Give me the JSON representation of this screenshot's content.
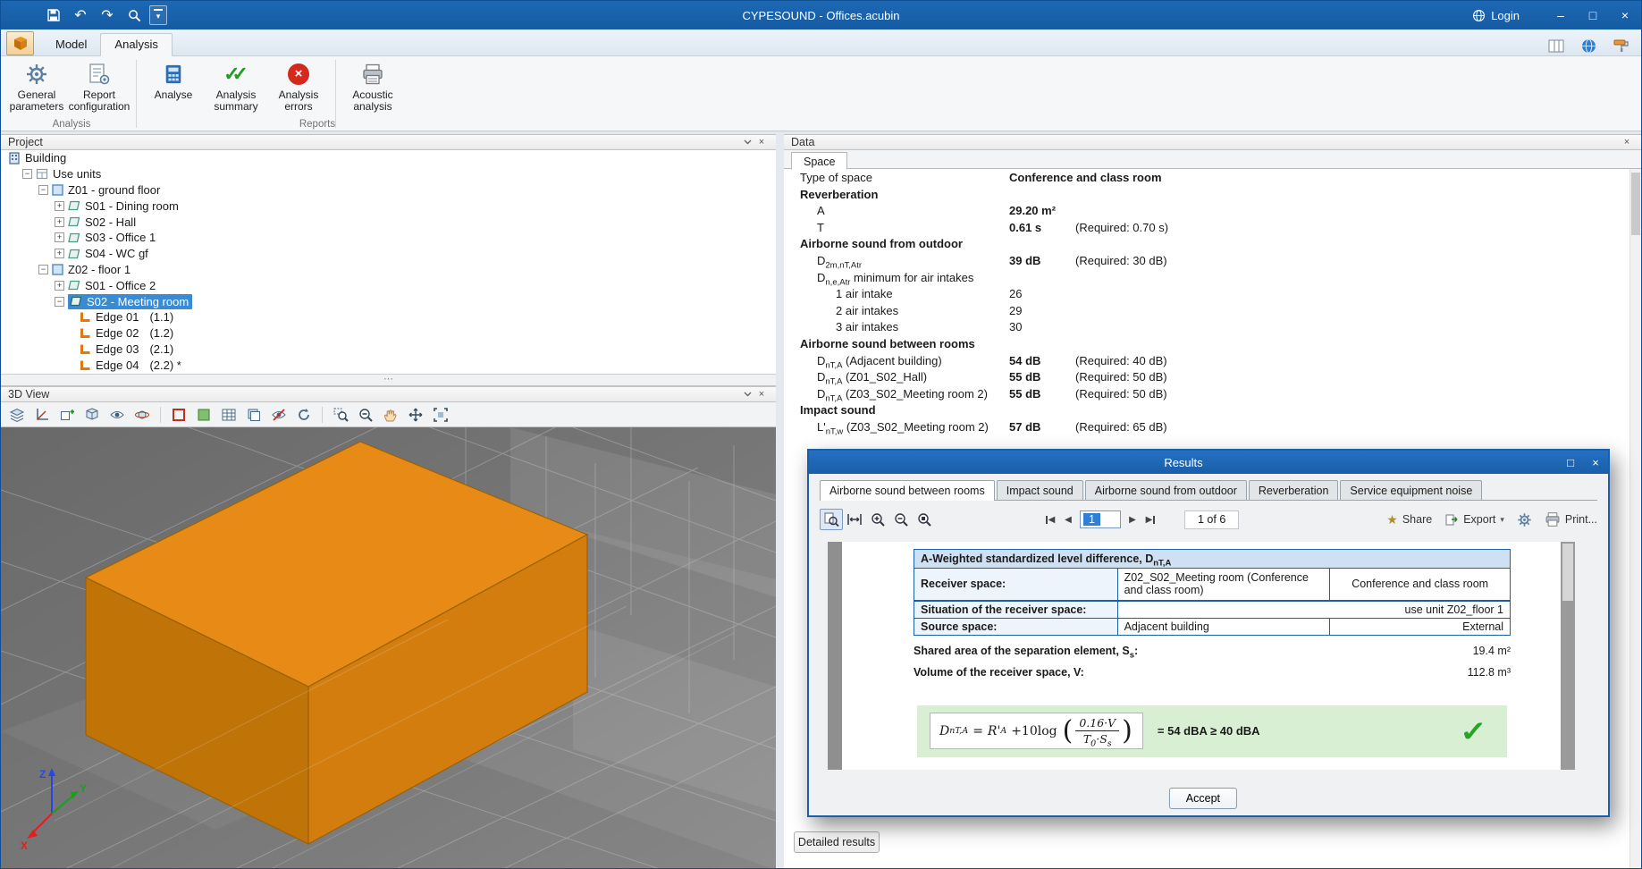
{
  "titlebar": {
    "title": "CYPESOUND - Offices.acubin",
    "login_label": "Login"
  },
  "tab_row": {
    "model_label": "Model",
    "analysis_label": "Analysis"
  },
  "ribbon": {
    "analysis_group_label": "Analysis",
    "reports_group_label": "Reports",
    "general_parameters": "General parameters",
    "report_configuration": "Report configuration",
    "analyse": "Analyse",
    "analysis_summary": "Analysis summary",
    "analysis_errors": "Analysis errors",
    "acoustic_analysis": "Acoustic analysis"
  },
  "project": {
    "title": "Project",
    "tree": [
      {
        "label": "Building"
      },
      {
        "label": "Use units"
      },
      {
        "label": "Z01 - ground floor"
      },
      {
        "label": "S01 - Dining room"
      },
      {
        "label": "S02 - Hall"
      },
      {
        "label": "S03 - Office 1"
      },
      {
        "label": "S04 - WC gf"
      },
      {
        "label": "Z02 - floor 1"
      },
      {
        "label": "S01 - Office 2"
      },
      {
        "label": "S02 - Meeting room"
      },
      {
        "label": "Edge 01",
        "suffix": "(1.1)"
      },
      {
        "label": "Edge 02",
        "suffix": "(1.2)"
      },
      {
        "label": "Edge 03",
        "suffix": "(2.1)"
      },
      {
        "label": "Edge 04",
        "suffix": "(2.2) *"
      }
    ]
  },
  "view3d": {
    "title": "3D View",
    "axes": {
      "x": "X",
      "y": "Y",
      "z": "Z"
    }
  },
  "data_panel": {
    "title": "Data",
    "tab_label": "Space",
    "rows": [
      {
        "b": "Type of space",
        "v": "Conference and class room"
      },
      {
        "b": "Reverberation"
      },
      {
        "b": "A",
        "v": "29.20 m²"
      },
      {
        "b": "T",
        "v": "0.61 s",
        "r": "(Required: 0.70 s)"
      },
      {
        "b": "Airborne sound from outdoor"
      },
      {
        "b": "D",
        "s": "2m,nT,Atr",
        "v": "39 dB",
        "r": "(Required: 30 dB)"
      },
      {
        "b": "D",
        "s": "n,e,Atr",
        "p": " minimum for air intakes"
      },
      {
        "b": "1 air intake",
        "v": "26"
      },
      {
        "b": "2 air intakes",
        "v": "29"
      },
      {
        "b": "3 air intakes",
        "v": "30"
      },
      {
        "b": "Airborne sound between rooms"
      },
      {
        "b": "D",
        "s": "nT,A",
        "p": " (Adjacent building)",
        "v": "54 dB",
        "r": "(Required: 40 dB)"
      },
      {
        "b": "D",
        "s": "nT,A",
        "p": " (Z01_S02_Hall)",
        "v": "55 dB",
        "r": "(Required: 50 dB)"
      },
      {
        "b": "D",
        "s": "nT,A",
        "p": " (Z03_S02_Meeting room 2)",
        "v": "55 dB",
        "r": "(Required: 50 dB)"
      },
      {
        "b": "Impact sound"
      },
      {
        "b": "L'",
        "s": "nT,w",
        "p": " (Z03_S02_Meeting room 2)",
        "v": "57 dB",
        "r": "(Required: 65 dB)"
      }
    ],
    "detailed_results_label": "Detailed results"
  },
  "results": {
    "title": "Results",
    "tabs": [
      "Airborne sound between rooms",
      "Impact sound",
      "Airborne sound from outdoor",
      "Reverberation",
      "Service equipment noise"
    ],
    "page_value": "1",
    "page_of": "1 of 6",
    "share_label": "Share",
    "export_label": "Export",
    "print_label": "Print...",
    "accept_label": "Accept",
    "doc": {
      "title_b": "A-Weighted standardized level difference, D",
      "title_s": "nT,A",
      "receiver_label": "Receiver space:",
      "receiver_value": "Z02_S02_Meeting room (Conference and class room)",
      "receiver_type": "Conference and class room",
      "situation_label": "Situation of the receiver space:",
      "situation_value": "use unit Z02_floor 1",
      "source_label": "Source space:",
      "source_value": "Adjacent building",
      "source_type": "External",
      "shared_b": "Shared area of the separation element, S",
      "shared_s": "s",
      "shared_p": ":",
      "shared_value": "19.4 m²",
      "volume_label": "Volume of the receiver space, V:",
      "volume_value": "112.8 m³",
      "formula": {
        "lhs_b": "D",
        "lhs_s": "nT,A",
        "eq": "=",
        "r_b": "R'",
        "r_s": "A",
        "op": "+10log",
        "num": "0.16·V",
        "den_b": "T",
        "den_s1": "0",
        "den_m": "·S",
        "den_s2": "s"
      },
      "result_text": "= 54 dBA ≥ 40 dBA"
    }
  }
}
